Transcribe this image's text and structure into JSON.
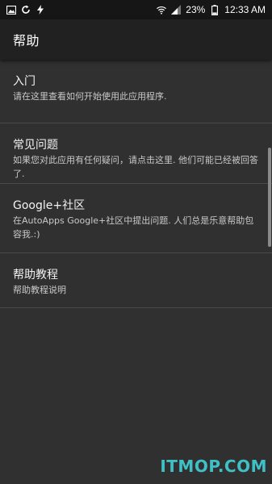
{
  "status_bar": {
    "left_icons": [
      "gallery-icon",
      "sync-icon",
      "flash-icon"
    ],
    "right_icons": [
      "wifi-icon",
      "signal-icon",
      "battery-icon"
    ],
    "battery_percent": "23%",
    "time": "12:33 AM"
  },
  "app_bar": {
    "title": "帮助"
  },
  "items": [
    {
      "title": "入门",
      "desc": "请在这里查看如何开始使用此应用程序."
    },
    {
      "title": "常见问题",
      "desc": "如果您对此应用有任何疑问，请点击这里. 他们可能已经被回答了."
    },
    {
      "title": "Google+社区",
      "desc": "在AutoApps Google+社区中提出问题. 人们总是乐意帮助包容我.:)"
    },
    {
      "title": "帮助教程",
      "desc": "帮助教程说明"
    }
  ],
  "watermark": "ITMOP.COM"
}
